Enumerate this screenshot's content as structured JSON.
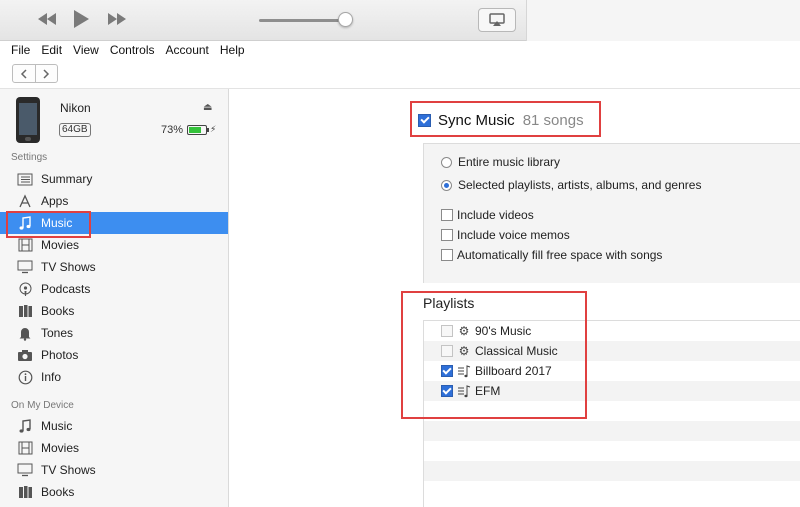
{
  "player": {
    "rewind_icon": "rewind-icon",
    "play_icon": "play-icon",
    "fastforward_icon": "fast-forward-icon",
    "volume_level": 0.88,
    "airplay_icon": "airplay-icon"
  },
  "menu": [
    "File",
    "Edit",
    "View",
    "Controls",
    "Account",
    "Help"
  ],
  "device": {
    "name": "Nikon",
    "capacity": "64GB",
    "battery": "73%",
    "battery_level": 0.73
  },
  "sidebar": {
    "settings_label": "Settings",
    "settings_items": [
      {
        "label": "Summary",
        "icon": "summary-icon"
      },
      {
        "label": "Apps",
        "icon": "apps-icon"
      },
      {
        "label": "Music",
        "icon": "music-note-icon",
        "selected": true
      },
      {
        "label": "Movies",
        "icon": "film-icon"
      },
      {
        "label": "TV Shows",
        "icon": "tv-icon"
      },
      {
        "label": "Podcasts",
        "icon": "podcast-icon"
      },
      {
        "label": "Books",
        "icon": "books-icon"
      },
      {
        "label": "Tones",
        "icon": "bell-icon"
      },
      {
        "label": "Photos",
        "icon": "camera-icon"
      },
      {
        "label": "Info",
        "icon": "info-icon"
      }
    ],
    "device_label": "On My Device",
    "device_items": [
      {
        "label": "Music",
        "icon": "music-note-icon"
      },
      {
        "label": "Movies",
        "icon": "film-icon"
      },
      {
        "label": "TV Shows",
        "icon": "tv-icon"
      },
      {
        "label": "Books",
        "icon": "books-icon"
      }
    ]
  },
  "sync": {
    "title": "Sync Music",
    "count": "81 songs",
    "checked": true
  },
  "options": {
    "entire_library": "Entire music library",
    "selected": "Selected playlists, artists, albums, and genres",
    "include_videos": "Include videos",
    "include_voice_memos": "Include voice memos",
    "autofill": "Automatically fill free space with songs"
  },
  "playlists": {
    "title": "Playlists",
    "items": [
      {
        "name": "90's Music",
        "checked": false,
        "icon": "smart-playlist-gear-icon"
      },
      {
        "name": "Classical Music",
        "checked": false,
        "icon": "smart-playlist-gear-icon"
      },
      {
        "name": "Billboard 2017",
        "checked": true,
        "icon": "playlist-icon"
      },
      {
        "name": "EFM",
        "checked": true,
        "icon": "playlist-icon"
      }
    ]
  }
}
